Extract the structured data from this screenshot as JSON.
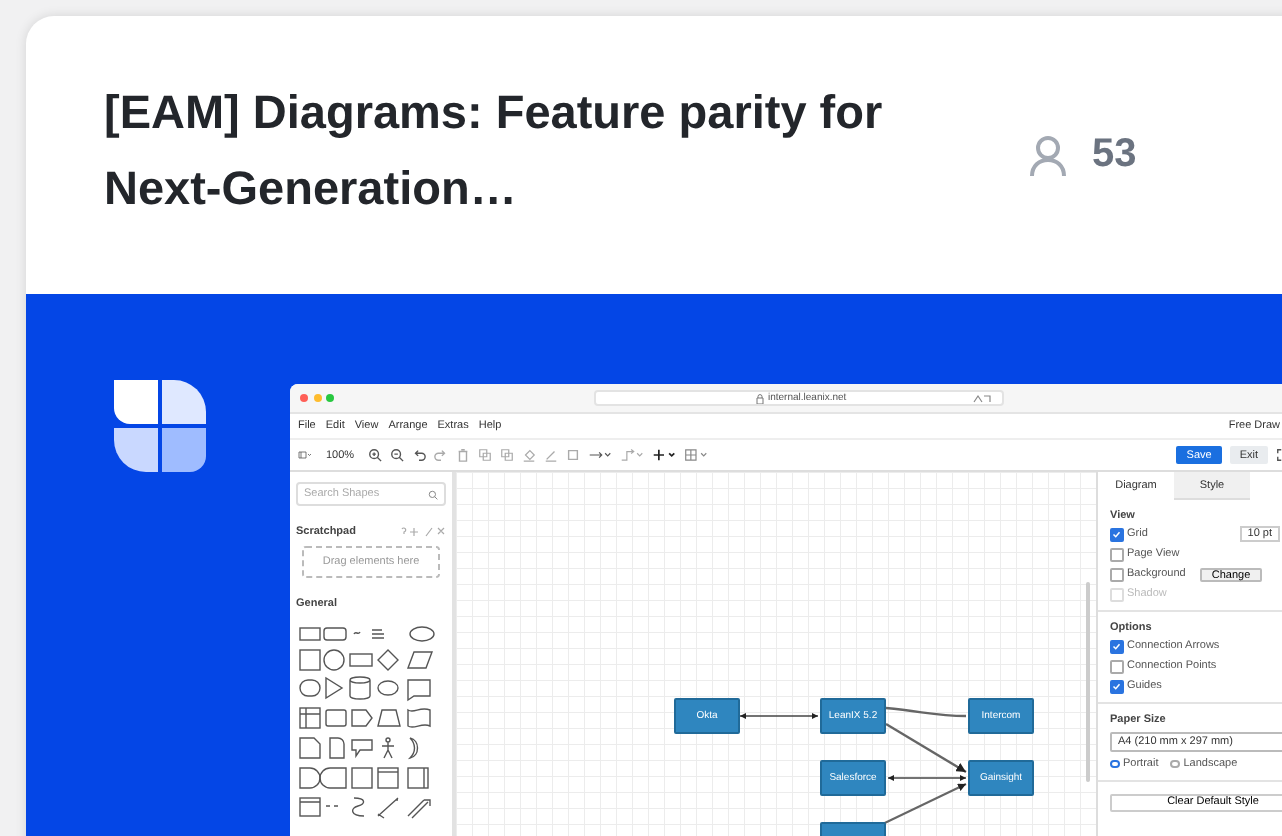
{
  "card": {
    "title": "[EAM] Diagrams: Feature parity for Next-Generation…",
    "followers": "53"
  },
  "app": {
    "url": "internal.leanix.net",
    "menu": [
      "File",
      "Edit",
      "View",
      "Arrange",
      "Extras",
      "Help"
    ],
    "mode": "Free Draw",
    "zoom": "100%",
    "save": "Save",
    "exit": "Exit",
    "sidebar": {
      "search_placeholder": "Search Shapes",
      "scratchpad": "Scratchpad",
      "drop_hint": "Drag elements here",
      "general": "General"
    },
    "nodes": [
      {
        "label": "Okta"
      },
      {
        "label": "LeanIX 5.2"
      },
      {
        "label": "Intercom"
      },
      {
        "label": "Salesforce"
      },
      {
        "label": "Gainsight"
      }
    ],
    "panel": {
      "tabs": [
        {
          "label": "Diagram",
          "selected": true
        },
        {
          "label": "Style",
          "selected": false
        }
      ],
      "view": {
        "title": "View",
        "options": [
          {
            "label": "Grid",
            "checked": true,
            "disabled": false,
            "value": "10 pt"
          },
          {
            "label": "Page View",
            "checked": false,
            "disabled": false
          },
          {
            "label": "Background",
            "checked": false,
            "disabled": false,
            "button": "Change"
          },
          {
            "label": "Shadow",
            "checked": false,
            "disabled": true
          }
        ]
      },
      "options": {
        "title": "Options",
        "options": [
          {
            "label": "Connection Arrows",
            "checked": true,
            "disabled": false
          },
          {
            "label": "Connection Points",
            "checked": false,
            "disabled": false
          },
          {
            "label": "Guides",
            "checked": true,
            "disabled": false
          }
        ]
      },
      "paper": {
        "title": "Paper Size",
        "size": "A4 (210 mm x 297 mm)",
        "orientations": [
          {
            "label": "Portrait",
            "selected": true
          },
          {
            "label": "Landscape",
            "selected": false
          }
        ]
      },
      "clear": "Clear Default Style"
    }
  }
}
